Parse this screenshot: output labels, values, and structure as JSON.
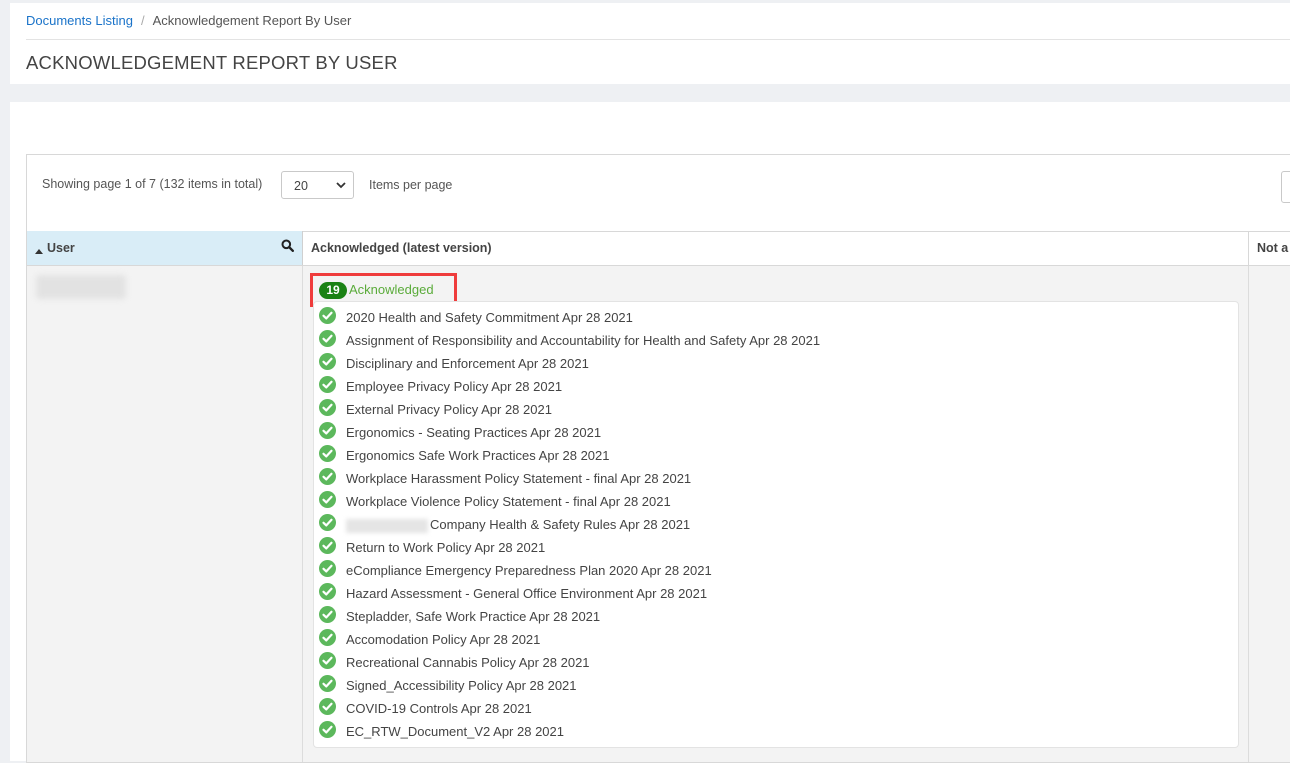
{
  "breadcrumb": {
    "parent": "Documents Listing",
    "current": "Acknowledgement Report By User"
  },
  "page_title": "ACKNOWLEDGEMENT REPORT BY USER",
  "pager": {
    "info": "Showing page 1 of 7 (132 items in total)",
    "page_size": "20",
    "items_per_page_label": "Items per page"
  },
  "columns": {
    "user": "User",
    "acknowledged": "Acknowledged (latest version)",
    "not_acknowledged": "Not a"
  },
  "row": {
    "ack_count": "19",
    "ack_label": "Acknowledged",
    "documents": [
      "2020 Health and Safety Commitment Apr 28 2021",
      "Assignment of Responsibility and Accountability for Health and Safety Apr 28 2021",
      "Disciplinary and Enforcement Apr 28 2021",
      "Employee Privacy Policy Apr 28 2021",
      "External Privacy Policy Apr 28 2021",
      "Ergonomics - Seating Practices Apr 28 2021",
      "Ergonomics Safe Work Practices Apr 28 2021",
      "Workplace Harassment Policy Statement - final Apr 28 2021",
      "Workplace Violence Policy Statement - final Apr 28 2021",
      "Company Health & Safety Rules Apr 28 2021",
      "Return to Work Policy Apr 28 2021",
      "eCompliance Emergency Preparedness Plan 2020 Apr 28 2021",
      "Hazard Assessment - General Office Environment Apr 28 2021",
      "Stepladder, Safe Work Practice Apr 28 2021",
      "Accomodation Policy Apr 28 2021",
      "Recreational Cannabis Policy Apr 28 2021",
      "Signed_Accessibility Policy Apr 28 2021",
      "COVID-19 Controls Apr 28 2021",
      "EC_RTW_Document_V2 Apr 28 2021"
    ]
  },
  "colors": {
    "link": "#1a73c9",
    "badge": "#1a8214",
    "ack_text": "#5aab3a",
    "check": "#5cb85c",
    "highlight": "#ef3c3c",
    "header_active": "#d9edf7"
  },
  "icons": {
    "sort": "sort-asc-icon",
    "search": "search-icon",
    "check": "check-circle-icon",
    "dropdown": "chevron-down-icon"
  }
}
